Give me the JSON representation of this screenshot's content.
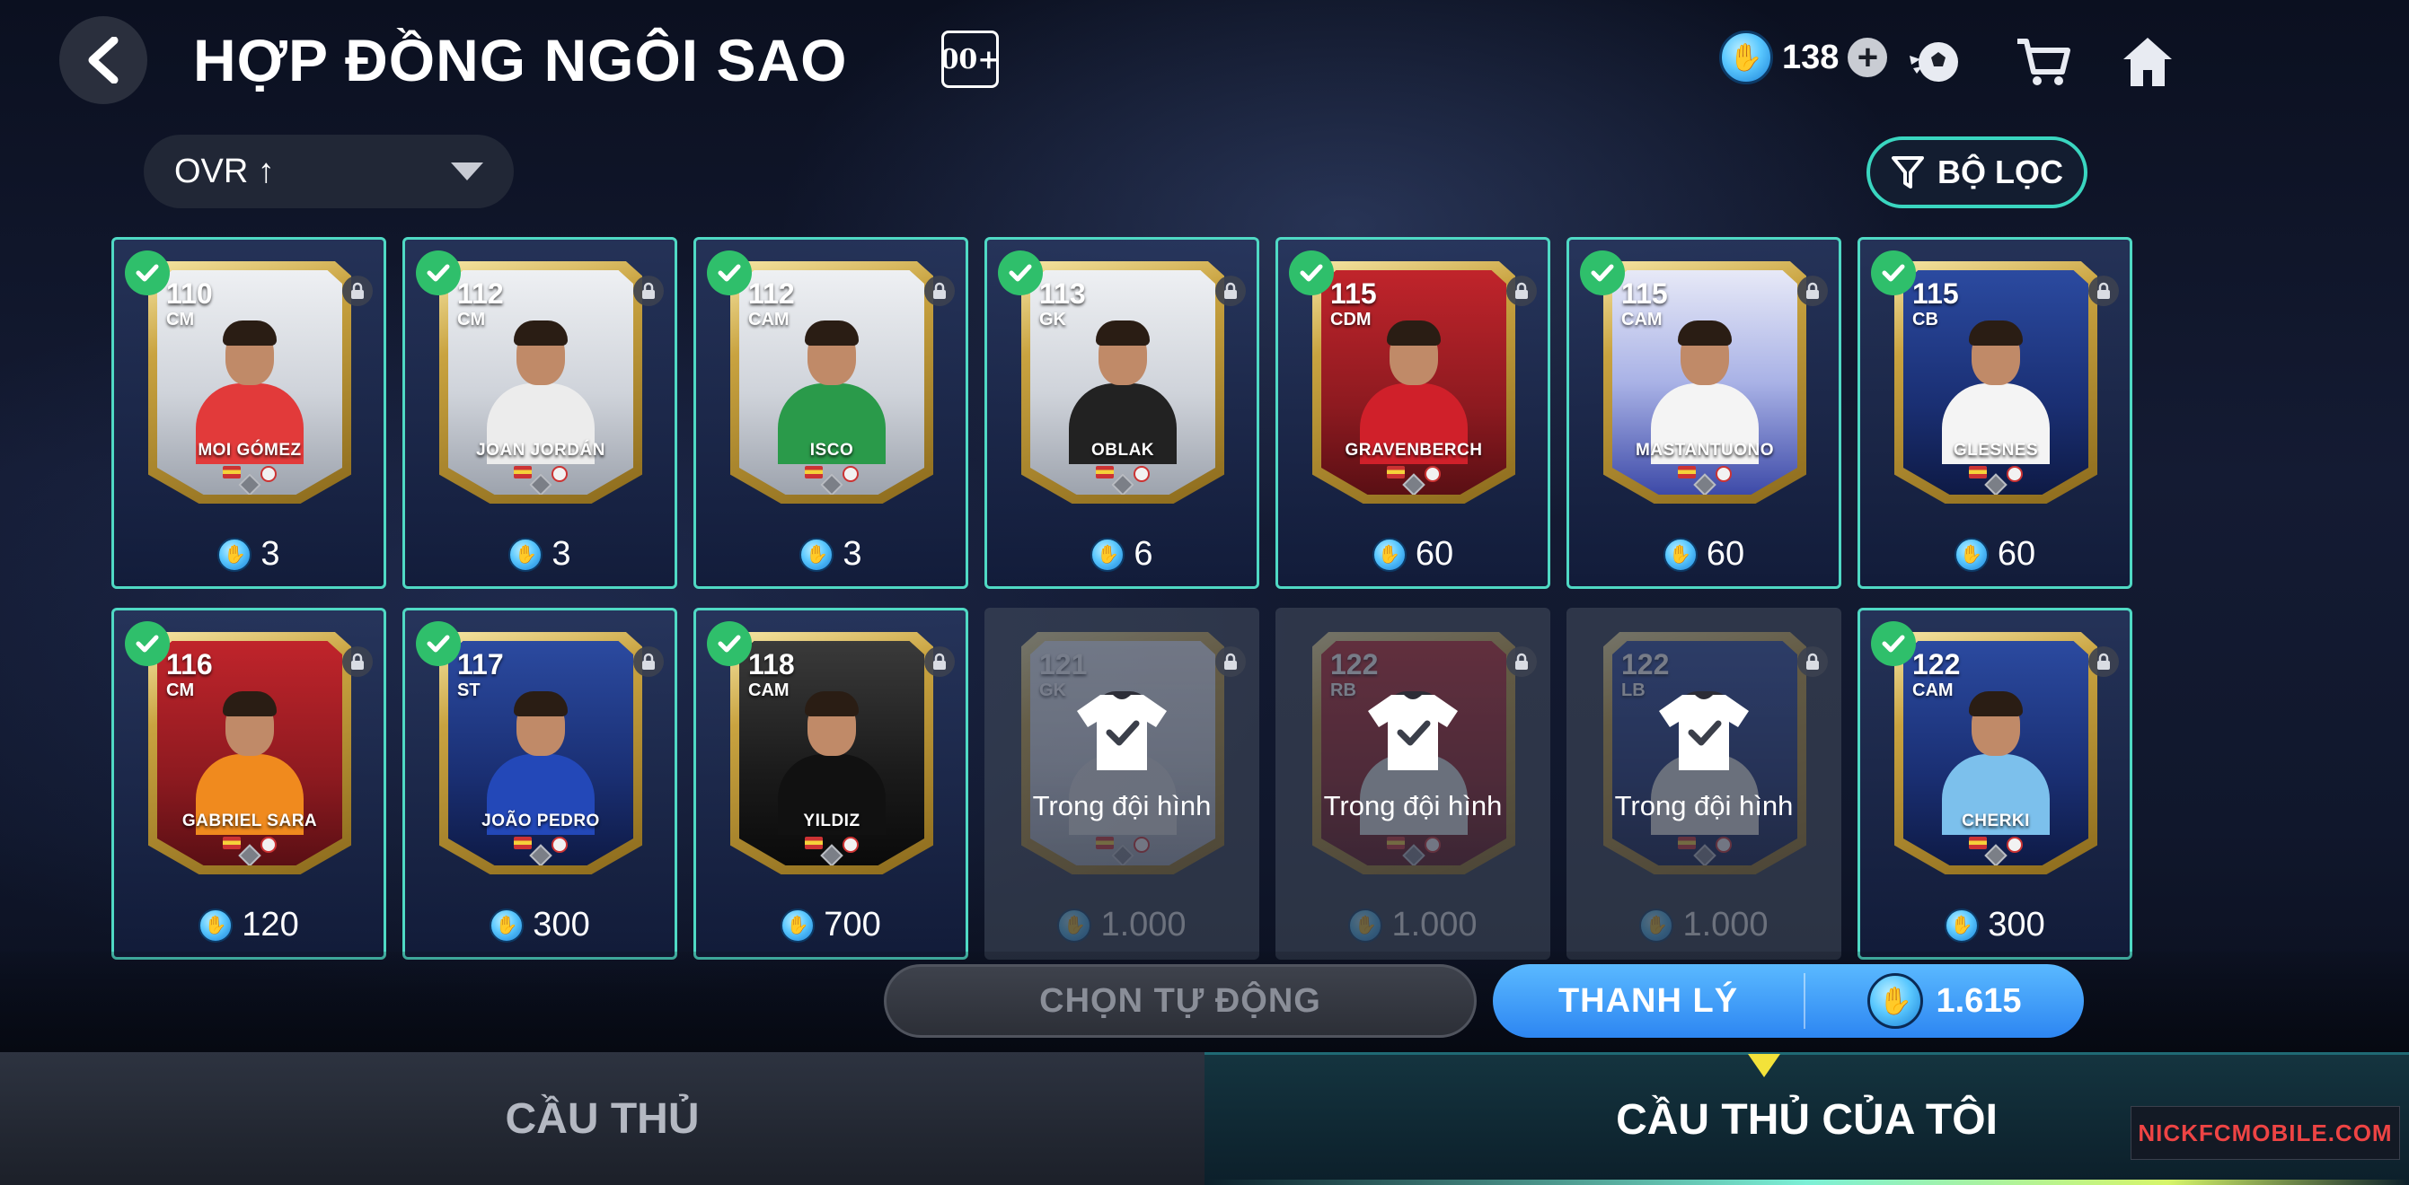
{
  "header": {
    "title": "HỢP ĐỒNG NGÔI SAO",
    "badge": "00+",
    "currency_value": "138",
    "icons": [
      "back-icon",
      "coin-icon",
      "plus-icon",
      "soccer-ball-icon",
      "cart-icon",
      "home-icon"
    ]
  },
  "sort": {
    "label": "OVR ↑"
  },
  "filter": {
    "label": "BỘ LỌC"
  },
  "cards": [
    {
      "rating": "110",
      "position": "CM",
      "name": "MOI GÓMEZ",
      "price": "3",
      "selected": true,
      "in_squad": false,
      "theme": "gold",
      "kit": "#e23a3a"
    },
    {
      "rating": "112",
      "position": "CM",
      "name": "JOAN JORDÁN",
      "price": "3",
      "selected": true,
      "in_squad": false,
      "theme": "gold",
      "kit": "#ececec"
    },
    {
      "rating": "112",
      "position": "CAM",
      "name": "ISCO",
      "price": "3",
      "selected": true,
      "in_squad": false,
      "theme": "gold",
      "kit": "#2a9a4a"
    },
    {
      "rating": "113",
      "position": "GK",
      "name": "OBLAK",
      "price": "6",
      "selected": true,
      "in_squad": false,
      "theme": "gold",
      "kit": "#222"
    },
    {
      "rating": "115",
      "position": "CDM",
      "name": "GRAVENBERCH",
      "price": "60",
      "selected": true,
      "in_squad": false,
      "theme": "red",
      "kit": "#d0202a"
    },
    {
      "rating": "115",
      "position": "CAM",
      "name": "MASTANTUONO",
      "price": "60",
      "selected": true,
      "in_squad": false,
      "theme": "purple",
      "kit": "#f4f4f4"
    },
    {
      "rating": "115",
      "position": "CB",
      "name": "GLESNES",
      "price": "60",
      "selected": true,
      "in_squad": false,
      "theme": "blue",
      "kit": "#f4f4f4"
    },
    {
      "rating": "116",
      "position": "CM",
      "name": "GABRIEL SARA",
      "price": "120",
      "selected": true,
      "in_squad": false,
      "theme": "red",
      "kit": "#f08a1e"
    },
    {
      "rating": "117",
      "position": "ST",
      "name": "JOÃO PEDRO",
      "price": "300",
      "selected": true,
      "in_squad": false,
      "theme": "blue",
      "kit": "#2348b8"
    },
    {
      "rating": "118",
      "position": "CAM",
      "name": "YILDIZ",
      "price": "700",
      "selected": true,
      "in_squad": false,
      "theme": "dark",
      "kit": "#111"
    },
    {
      "rating": "121",
      "position": "GK",
      "name": "",
      "price": "1.000",
      "selected": false,
      "in_squad": true,
      "theme": "gold",
      "kit": "#ddd"
    },
    {
      "rating": "122",
      "position": "RB",
      "name": "",
      "price": "1.000",
      "selected": false,
      "in_squad": true,
      "theme": "red",
      "kit": "#ddd"
    },
    {
      "rating": "122",
      "position": "LB",
      "name": "",
      "price": "1.000",
      "selected": false,
      "in_squad": true,
      "theme": "blue",
      "kit": "#ddd"
    },
    {
      "rating": "122",
      "position": "CAM",
      "name": "CHERKI",
      "price": "300",
      "selected": true,
      "in_squad": false,
      "theme": "blue",
      "kit": "#7cc0ec"
    }
  ],
  "in_squad_label": "Trong đội hình",
  "actions": {
    "auto_label": "CHỌN TỰ ĐỘNG",
    "sell_label": "THANH LÝ",
    "sell_total": "1.615"
  },
  "tabs": [
    {
      "label": "CẦU THỦ",
      "active": false
    },
    {
      "label": "CẦU THỦ CỦA TÔI",
      "active": true
    }
  ],
  "watermark": "NICKFCMOBILE.COM",
  "colors": {
    "accent": "#4fd9c4",
    "check": "#2fbf6b",
    "sell_button": "#2d86f2",
    "tab_indicator": "#f3e23a"
  }
}
